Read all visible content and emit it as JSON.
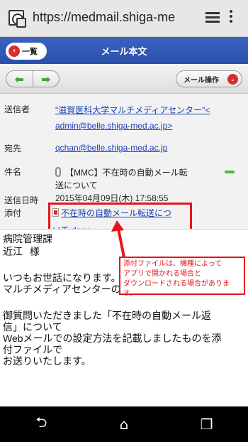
{
  "browser": {
    "url": "https://medmail.shiga-me"
  },
  "header": {
    "back_label": "一覧",
    "back_chevron": "‹",
    "title": "メール本文"
  },
  "toolbar": {
    "prev_arrow": "⬅",
    "next_arrow": "➡",
    "mail_ops_label": "メール操作",
    "mail_ops_chevron": "⌄"
  },
  "mail": {
    "sender_label": "送信者",
    "sender_line1": "\"滋賀医科大学マルチメディアセンター\"<",
    "sender_line2": "admin@belle.shiga-med.ac.jp>",
    "to_label": "宛先",
    "to_value": "qchan@belle.shiga-med.ac.jp",
    "subject_label": "件名",
    "subject_line1": "【MMC】不在時の自動メール転",
    "subject_line2": "送について",
    "date_label": "送信日時",
    "date_value": "2015年04月09日(木) 17:58:55",
    "attach_label": "添付",
    "attach_line1": "不在時の自動メール転送につ",
    "attach_line2": "いて.docx"
  },
  "body": {
    "line1": "病院管理課",
    "line2_name": "近江",
    "line2_suffix": "様",
    "line3": "いつもお世話になります。",
    "line4": "マルチメディアセンターの滋賀です。",
    "line5": "御質問いただきました「不在時の自動メール返",
    "line6": "信」について",
    "line7": "Webメールでの設定方法を記載しましたものを添",
    "line8": "付ファイルで",
    "line9": "お送りいたします。"
  },
  "callout": {
    "line1": "添付ファイルは、機種によって",
    "line2": "アプリで開かれる場合と",
    "line3": "ダウンロードされる場合があります。"
  },
  "bottom_nav": {
    "back_icon": "⮌",
    "home_icon": "⌂",
    "recents_icon": "❐"
  },
  "colors": {
    "header_blue": "#2a4fa8",
    "link_blue": "#1a3fb4",
    "callout_red": "#e8141b",
    "nav_green": "#3ea83e"
  }
}
